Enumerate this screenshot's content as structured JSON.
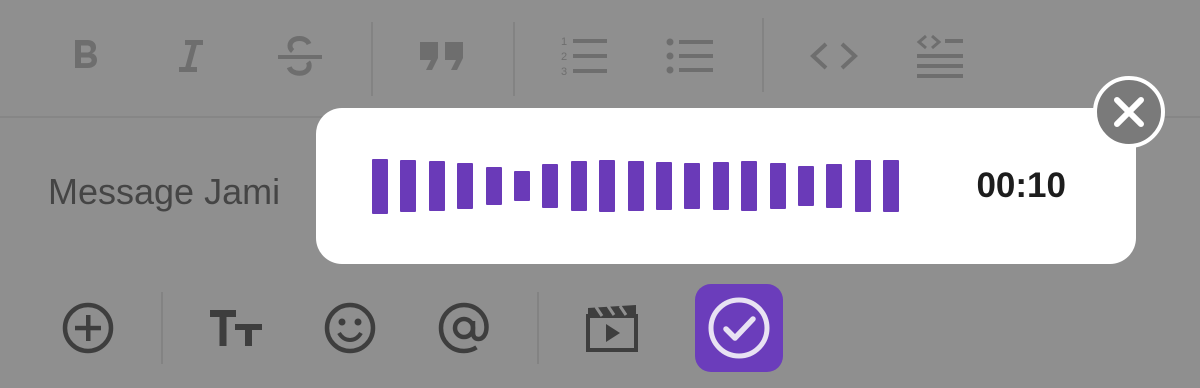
{
  "toolbar": {
    "icons": [
      "bold-icon",
      "italic-icon",
      "strikethrough-icon",
      "quote-icon",
      "numbered-list-icon",
      "bulleted-list-icon",
      "code-icon",
      "code-block-icon"
    ]
  },
  "composer": {
    "placeholder": "Message Jami"
  },
  "recording": {
    "timer": "00:10",
    "bar_levels": [
      0.55,
      0.52,
      0.5,
      0.46,
      0.38,
      0.3,
      0.44,
      0.5,
      0.52,
      0.5,
      0.48,
      0.46,
      0.48,
      0.5,
      0.46,
      0.4,
      0.44,
      0.52,
      0.52
    ],
    "bar_color": "#6a3ab8"
  },
  "bottom_toolbar": {
    "icons": [
      "add-icon",
      "text-format-icon",
      "emoji-icon",
      "mention-icon",
      "video-clip-icon",
      "send-check-icon"
    ]
  },
  "colors": {
    "accent": "#6b3dbb",
    "overlay_bg": "#8f8f8f"
  }
}
